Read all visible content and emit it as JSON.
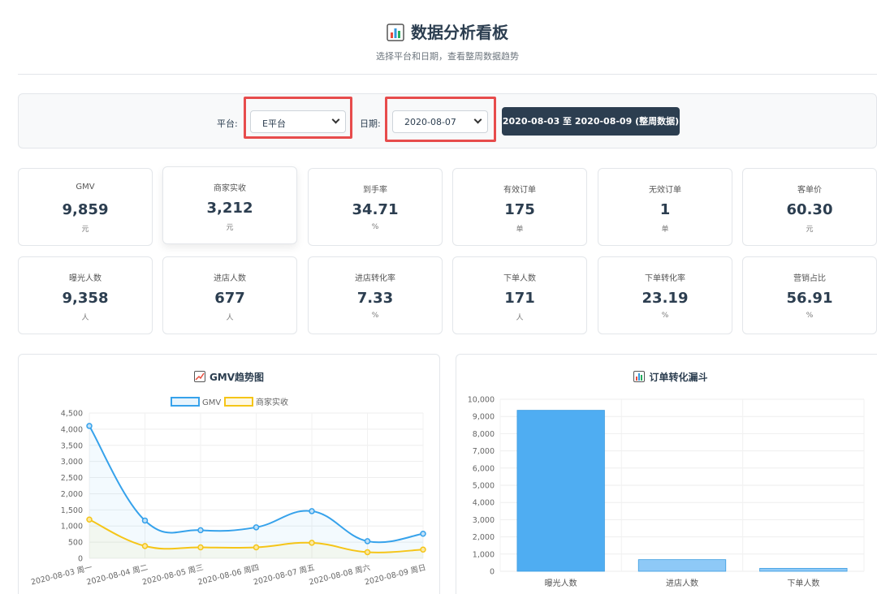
{
  "header": {
    "title": "数据分析看板",
    "subtitle": "选择平台和日期，查看整周数据趋势",
    "title_icon": "bar-chart-icon"
  },
  "filters": {
    "platform_label": "平台:",
    "platform_value": "E平台",
    "date_label": "日期:",
    "date_value": "2020-08-07",
    "range_button": "2020-08-03 至 2020-08-09 (整周数据)"
  },
  "metrics": [
    {
      "label": "GMV",
      "value": "9,859",
      "unit": "元"
    },
    {
      "label": "商家实收",
      "value": "3,212",
      "unit": "元"
    },
    {
      "label": "到手率",
      "value": "34.71",
      "unit": "%"
    },
    {
      "label": "有效订单",
      "value": "175",
      "unit": "单"
    },
    {
      "label": "无效订单",
      "value": "1",
      "unit": "单"
    },
    {
      "label": "客单价",
      "value": "60.30",
      "unit": "元"
    },
    {
      "label": "曝光人数",
      "value": "9,358",
      "unit": "人"
    },
    {
      "label": "进店人数",
      "value": "677",
      "unit": "人"
    },
    {
      "label": "进店转化率",
      "value": "7.33",
      "unit": "%"
    },
    {
      "label": "下单人数",
      "value": "171",
      "unit": "人"
    },
    {
      "label": "下单转化率",
      "value": "23.19",
      "unit": "%"
    },
    {
      "label": "营销占比",
      "value": "56.91",
      "unit": "%"
    }
  ],
  "colors": {
    "gmv": "#36a2eb",
    "merchant": "#f5c518",
    "funnel_main": "#4fadf2",
    "funnel_light": "#8ec9f7",
    "highlight": "#e74c4c",
    "button": "#2c3e50"
  },
  "chart_data": [
    {
      "type": "line",
      "title": "GMV趋势图",
      "title_icon": "line-chart-icon",
      "x": [
        "2020-08-03 周一",
        "2020-08-04 周二",
        "2020-08-05 周三",
        "2020-08-06 周四",
        "2020-08-07 周五",
        "2020-08-08 周六",
        "2020-08-09 周日"
      ],
      "series": [
        {
          "name": "GMV",
          "values": [
            4100,
            1170,
            870,
            960,
            1460,
            530,
            760
          ]
        },
        {
          "name": "商家实收",
          "values": [
            1200,
            380,
            340,
            340,
            480,
            190,
            270
          ]
        }
      ],
      "ylim": [
        0,
        4500
      ],
      "yticks": [
        "0",
        "500",
        "1,000",
        "1,500",
        "2,000",
        "2,500",
        "3,000",
        "3,500",
        "4,000",
        "4,500"
      ],
      "legend": "top",
      "grid": true
    },
    {
      "type": "bar",
      "title": "订单转化漏斗",
      "title_icon": "bar-chart-icon",
      "categories": [
        "曝光人数",
        "进店人数",
        "下单人数"
      ],
      "values": [
        9358,
        677,
        171
      ],
      "ylim": [
        0,
        10000
      ],
      "yticks": [
        "0",
        "1,000",
        "2,000",
        "3,000",
        "4,000",
        "5,000",
        "6,000",
        "7,000",
        "8,000",
        "9,000",
        "10,000"
      ],
      "grid": true
    }
  ]
}
